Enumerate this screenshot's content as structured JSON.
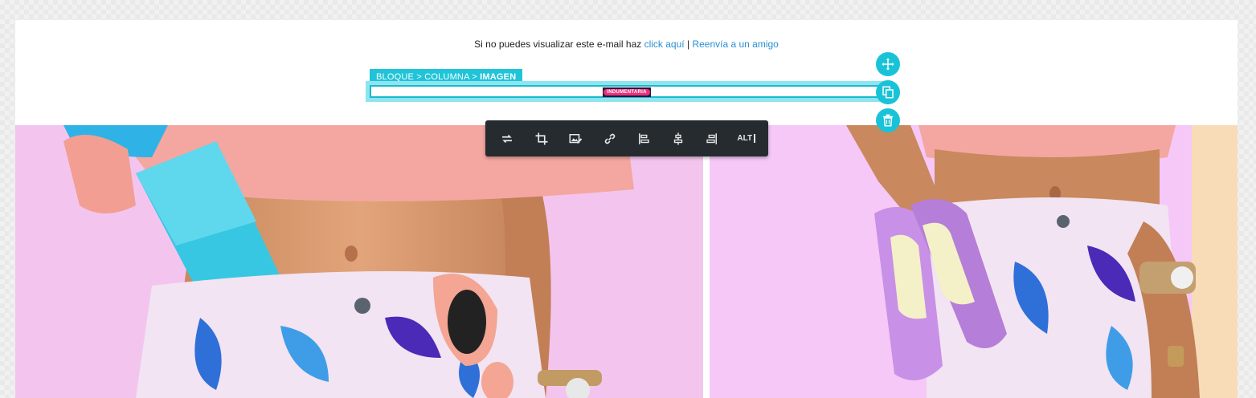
{
  "preheader": {
    "text": "Si no puedes visualizar este e-mail haz",
    "link_click": "click aquí",
    "separator": "|",
    "link_forward": "Reenvía a un amigo"
  },
  "breadcrumb": {
    "block": "BLOQUE",
    "sep1": " > ",
    "column": "COLUMNA",
    "sep2": " > ",
    "image": "IMAGEN"
  },
  "logo": {
    "text": "INDUMENTARIA"
  },
  "side_actions": [
    {
      "icon": "move-icon"
    },
    {
      "icon": "duplicate-icon"
    },
    {
      "icon": "trash-icon"
    }
  ],
  "toolbar": {
    "alt_label": "ALT",
    "buttons": [
      "replace-icon",
      "crop-icon",
      "edit-image-icon",
      "link-icon",
      "align-left-icon",
      "align-center-icon",
      "align-right-icon",
      "alt-text-icon"
    ]
  },
  "colors": {
    "accent": "#19c3d7",
    "link": "#2a8fd0",
    "toolbar_bg": "#262b30",
    "logo_pink": "#e8317c"
  }
}
